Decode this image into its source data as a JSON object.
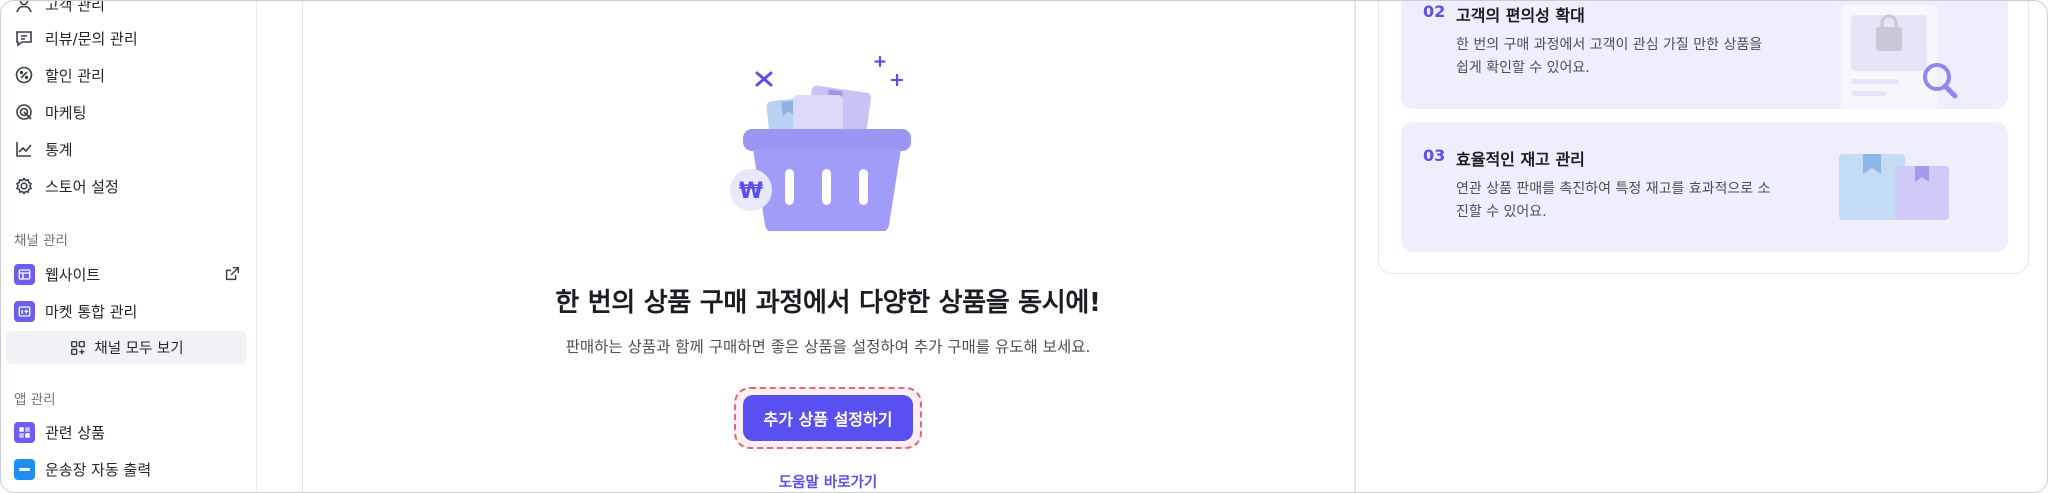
{
  "sidebar": {
    "items": [
      {
        "label": "고객 관리",
        "icon": "customer-icon"
      },
      {
        "label": "리뷰/문의 관리",
        "icon": "chat-icon"
      },
      {
        "label": "할인 관리",
        "icon": "discount-icon"
      },
      {
        "label": "마케팅",
        "icon": "marketing-icon"
      },
      {
        "label": "통계",
        "icon": "chart-icon"
      },
      {
        "label": "스토어 설정",
        "icon": "gear-icon"
      }
    ],
    "channel_section": {
      "title": "채널 관리",
      "items": [
        {
          "label": "웹사이트",
          "icon": "website-icon"
        },
        {
          "label": "마켓 통합 관리",
          "icon": "market-icon"
        }
      ],
      "view_all": "채널 모두 보기"
    },
    "app_section": {
      "title": "앱 관리",
      "items": [
        {
          "label": "관련 상품",
          "icon": "related-products-icon"
        },
        {
          "label": "운송장 자동 출력",
          "icon": "waybill-icon"
        }
      ]
    }
  },
  "main": {
    "headline": "한 번의 상품 구매 과정에서 다양한 상품을 동시에!",
    "subline": "판매하는 상품과 함께 구매하면 좋은 상품을 설정하여 추가 구매를 유도해 보세요.",
    "cta_label": "추가 상품 설정하기",
    "help_link": "도움말 바로가기",
    "currency_symbol": "₩"
  },
  "benefits": [
    {
      "num": "02",
      "title": "고객의 편의성 확대",
      "desc": "한 번의 구매 과정에서 고객이 관심 가질 만한 상품을 쉽게 확인할 수 있어요."
    },
    {
      "num": "03",
      "title": "효율적인 재고 관리",
      "desc": "연관 상품 판매를 촉진하여 특정 재고를 효과적으로 소진할 수 있어요."
    }
  ],
  "colors": {
    "accent": "#5a4ff0",
    "benefit_bg": "#eeeefd",
    "cta_outline": "#e5667a"
  }
}
